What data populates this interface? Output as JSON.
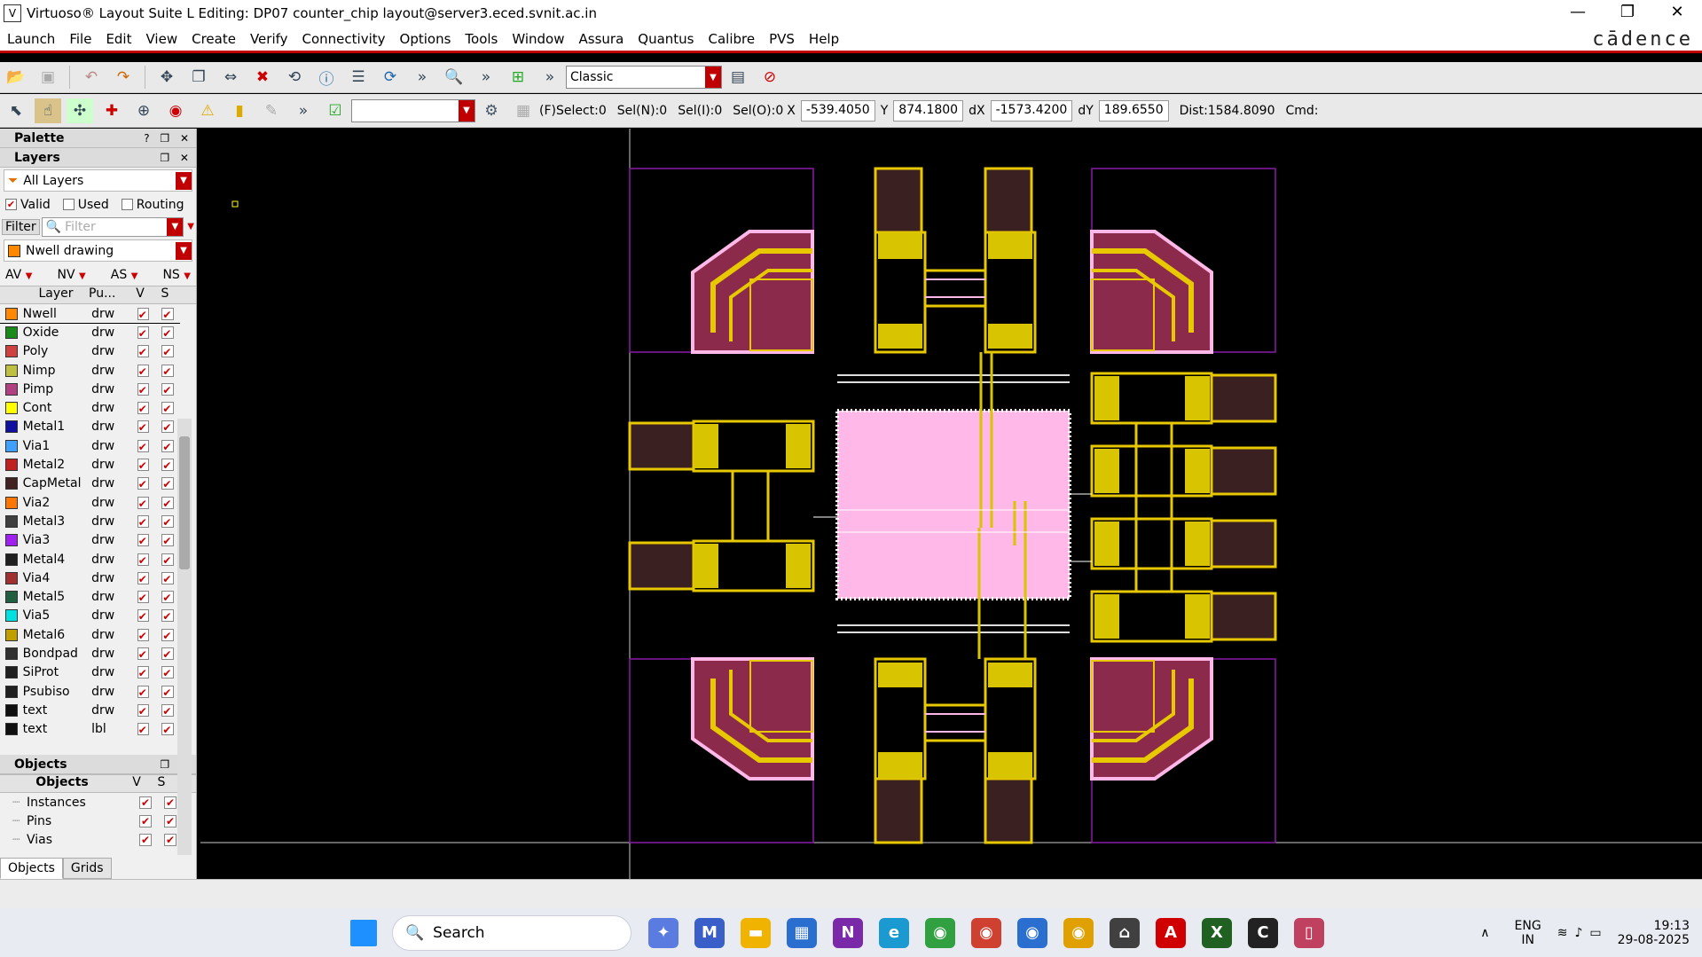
{
  "window": {
    "title": "Virtuoso® Layout Suite L Editing: DP07 counter_chip layout@server3.eced.svnit.ac.in",
    "minimize": "—",
    "restore": "❐",
    "close": "✕"
  },
  "menu": {
    "items": [
      "Launch",
      "File",
      "Edit",
      "View",
      "Create",
      "Verify",
      "Connectivity",
      "Options",
      "Tools",
      "Window",
      "Assura",
      "Quantus",
      "Calibre",
      "PVS",
      "Help"
    ],
    "brand": "cādence"
  },
  "toolbar": {
    "workspace": "Classic",
    "more": "»",
    "status": {
      "fselect": "(F)Select:0",
      "seln": "Sel(N):0",
      "seli": "Sel(I):0",
      "selo": "Sel(O):0",
      "x_label": "X",
      "x_value": "-539.4050",
      "y_label": "Y",
      "y_value": "874.1800",
      "dx_label": "dX",
      "dx_value": "-1573.4200",
      "dy_label": "dY",
      "dy_value": "189.6550",
      "dist": "Dist:1584.8090",
      "cmd": "Cmd:"
    }
  },
  "palette": {
    "title": "Palette",
    "layers_title": "Layers",
    "filter_mode": "All Layers",
    "valid": "Valid",
    "used": "Used",
    "routing": "Routing",
    "filter_btn": "Filter",
    "filter_placeholder": "Filter",
    "current_layer": "Nwell drawing",
    "visibility": [
      "AV",
      "NV",
      "AS",
      "NS"
    ],
    "columns": {
      "layer": "Layer",
      "purpose": "Pu...",
      "v": "V",
      "s": "S"
    },
    "layers": [
      {
        "name": "Nwell",
        "purpose": "drw",
        "color": "#ff8800"
      },
      {
        "name": "Oxide",
        "purpose": "drw",
        "color": "#1a8a1a"
      },
      {
        "name": "Poly",
        "purpose": "drw",
        "color": "#d04040"
      },
      {
        "name": "Nimp",
        "purpose": "drw",
        "color": "#c0c040"
      },
      {
        "name": "Pimp",
        "purpose": "drw",
        "color": "#b04080"
      },
      {
        "name": "Cont",
        "purpose": "drw",
        "color": "#ffff00"
      },
      {
        "name": "Metal1",
        "purpose": "drw",
        "color": "#1010a0"
      },
      {
        "name": "Via1",
        "purpose": "drw",
        "color": "#40a0ff"
      },
      {
        "name": "Metal2",
        "purpose": "drw",
        "color": "#c02020"
      },
      {
        "name": "CapMetal",
        "purpose": "drw",
        "color": "#402020"
      },
      {
        "name": "Via2",
        "purpose": "drw",
        "color": "#ff7700"
      },
      {
        "name": "Metal3",
        "purpose": "drw",
        "color": "#404040"
      },
      {
        "name": "Via3",
        "purpose": "drw",
        "color": "#a020f0"
      },
      {
        "name": "Metal4",
        "purpose": "drw",
        "color": "#202020"
      },
      {
        "name": "Via4",
        "purpose": "drw",
        "color": "#a03030"
      },
      {
        "name": "Metal5",
        "purpose": "drw",
        "color": "#206040"
      },
      {
        "name": "Via5",
        "purpose": "drw",
        "color": "#00e0e0"
      },
      {
        "name": "Metal6",
        "purpose": "drw",
        "color": "#c0a000"
      },
      {
        "name": "Bondpad",
        "purpose": "drw",
        "color": "#303030"
      },
      {
        "name": "SiProt",
        "purpose": "drw",
        "color": "#202020"
      },
      {
        "name": "Psubiso",
        "purpose": "drw",
        "color": "#202020"
      },
      {
        "name": "text",
        "purpose": "drw",
        "color": "#101010"
      },
      {
        "name": "text",
        "purpose": "lbl",
        "color": "#101010"
      }
    ],
    "objects_title": "Objects",
    "objects_col": "Objects",
    "objects": [
      "Instances",
      "Pins",
      "Vias"
    ],
    "tabs": [
      "Objects",
      "Grids"
    ]
  },
  "taskbar": {
    "search": "Search",
    "lang1": "ENG",
    "lang2": "IN",
    "time": "19:13",
    "date": "29-08-2025"
  }
}
